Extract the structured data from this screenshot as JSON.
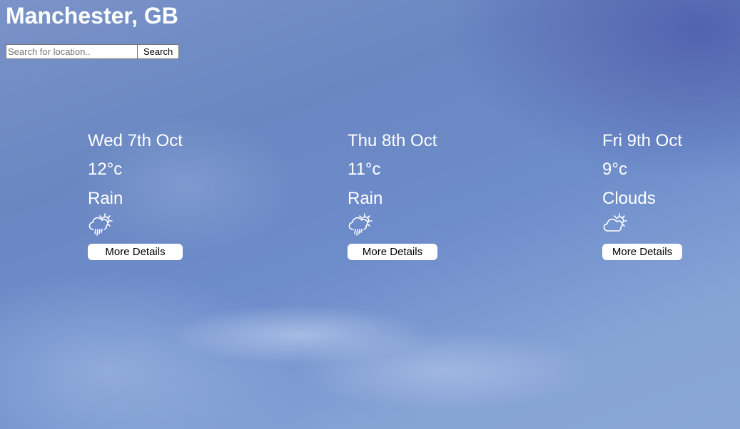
{
  "location": {
    "title": "Manchester, GB"
  },
  "search": {
    "placeholder": "Search for location..",
    "value": "",
    "button_label": "Search"
  },
  "forecast": [
    {
      "day": "Wed 7th Oct",
      "temperature": "12°c",
      "condition": "Rain",
      "icon": "rain-sun-icon",
      "button_label": "More Details"
    },
    {
      "day": "Thu 8th Oct",
      "temperature": "11°c",
      "condition": "Rain",
      "icon": "rain-sun-icon",
      "button_label": "More Details"
    },
    {
      "day": "Fri 9th Oct",
      "temperature": "9°c",
      "condition": "Clouds",
      "icon": "cloud-sun-icon",
      "button_label": "More Details"
    }
  ],
  "colors": {
    "text": "#ffffff",
    "sky_background": "#6d8cca",
    "button_background": "#ffffff"
  }
}
